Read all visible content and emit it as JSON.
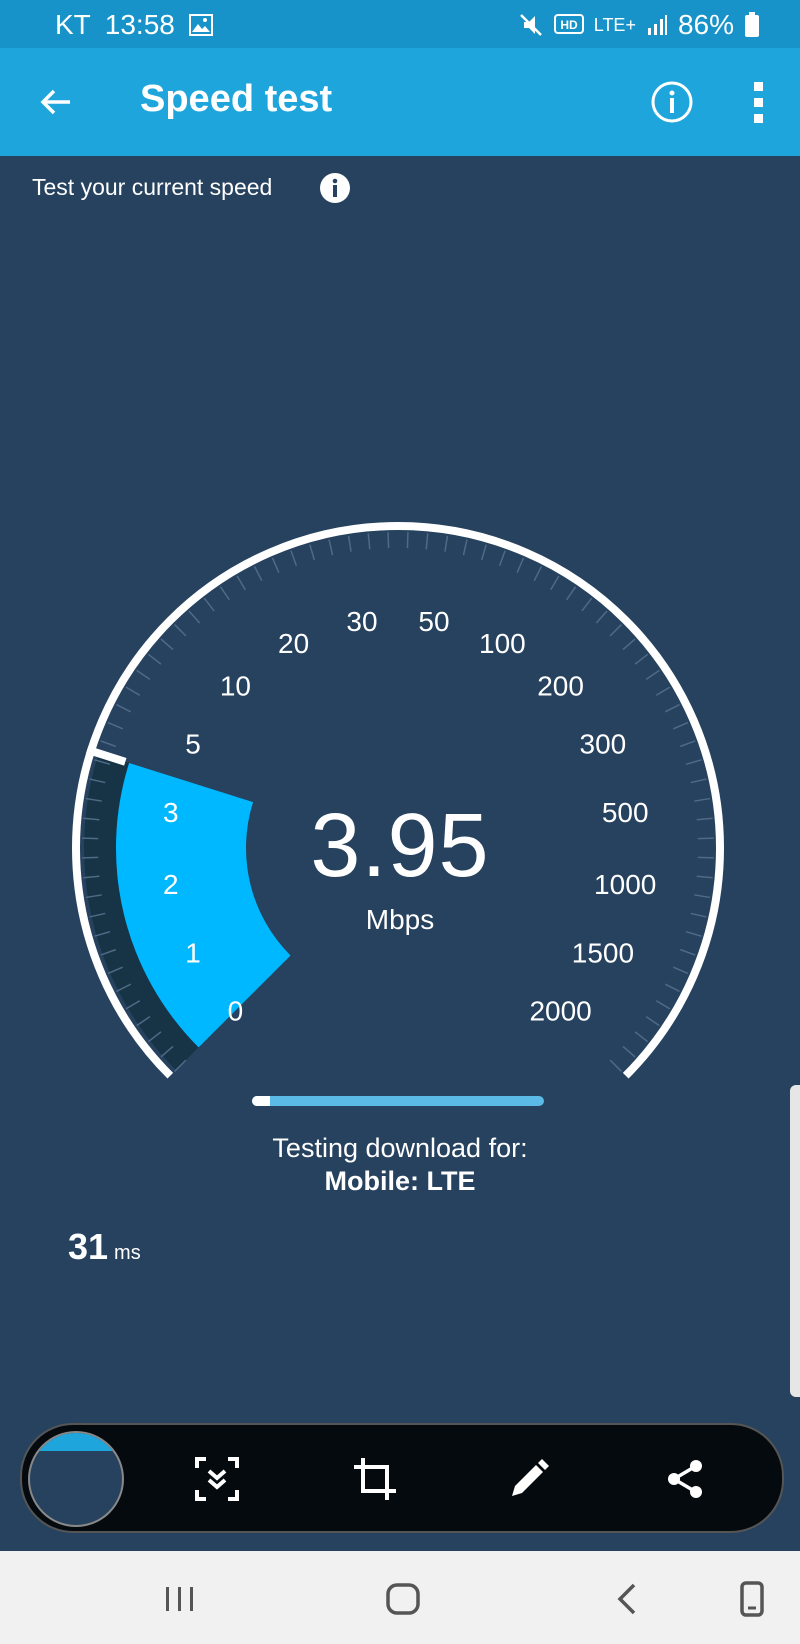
{
  "status_bar": {
    "carrier": "KT",
    "time": "13:58",
    "network": "LTE+",
    "battery": "86%",
    "icons": [
      "gallery-icon",
      "mute-icon",
      "hd-icon",
      "signal-icon",
      "battery-icon"
    ]
  },
  "app_bar": {
    "title": "Speed test",
    "icons": [
      "back-arrow-icon",
      "info-circle-icon",
      "more-vert-icon"
    ]
  },
  "subtitle": "Test your current speed",
  "gauge": {
    "left_ticks": [
      "0",
      "1",
      "2",
      "3",
      "5",
      "10",
      "20",
      "30"
    ],
    "right_ticks": [
      "50",
      "100",
      "200",
      "300",
      "500",
      "1000",
      "1500",
      "2000"
    ],
    "value": "3.95",
    "unit": "Mbps",
    "accent": "#00b8ff"
  },
  "progress_fraction": 0.06,
  "status": {
    "line1": "Testing download for:",
    "line2": "Mobile: LTE"
  },
  "ping": {
    "value": "31",
    "unit": "ms"
  },
  "screenshot_toolbar": {
    "icons": [
      "scroll-capture-icon",
      "crop-icon",
      "edit-pen-icon",
      "share-icon"
    ]
  },
  "nav_bar": {
    "icons": [
      "recents-icon",
      "home-icon",
      "back-icon",
      "rotate-icon"
    ]
  }
}
